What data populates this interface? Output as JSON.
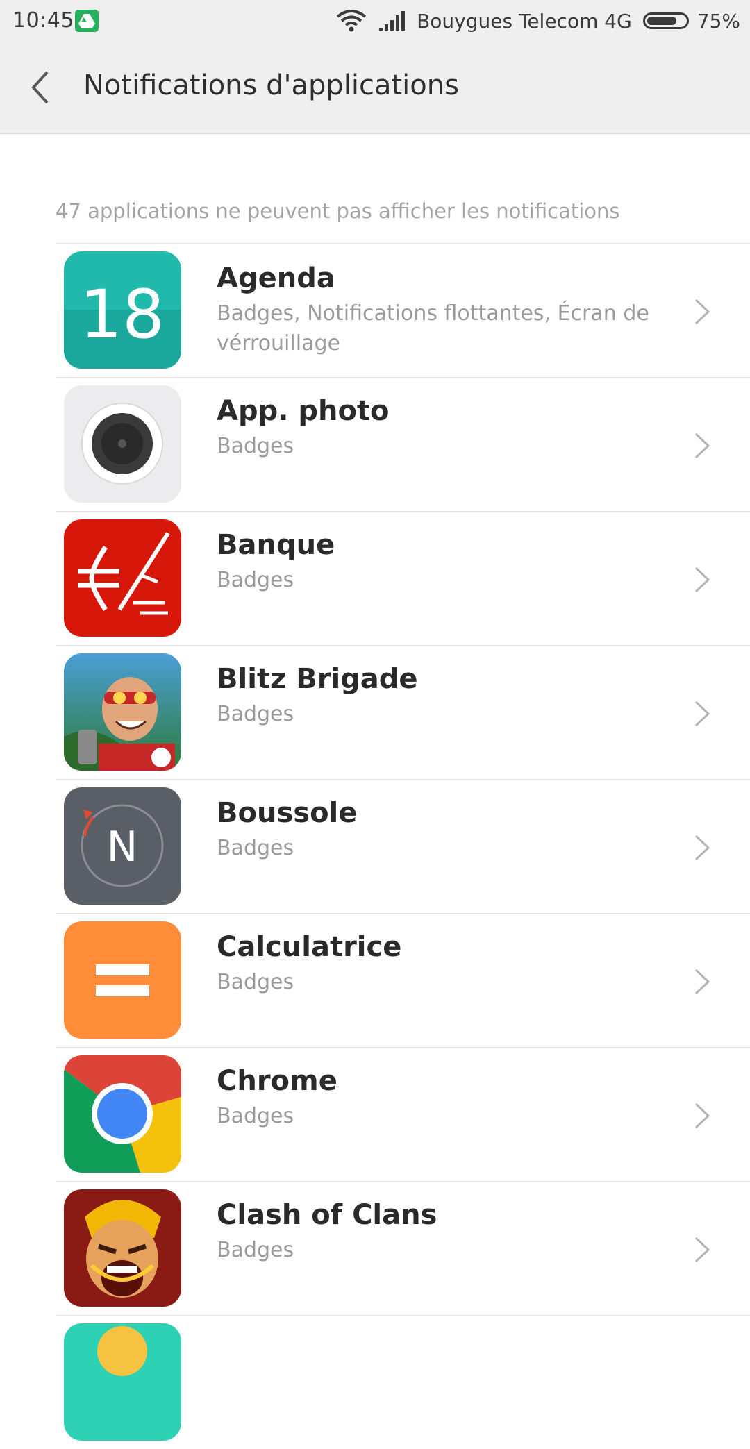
{
  "status_bar": {
    "time": "10:45",
    "carrier": "Bouygues Telecom 4G",
    "battery": "75%",
    "icons": [
      "google-drive-icon",
      "wifi-icon",
      "signal-icon",
      "battery-icon"
    ]
  },
  "header": {
    "title": "Notifications d'applications",
    "back_icon": "chevron-left-icon"
  },
  "section": {
    "label": "47 applications ne peuvent pas afficher les notifications"
  },
  "apps": [
    {
      "name": "Agenda",
      "detail": "Badges, Notifications flottantes, Écran de vérrouillage",
      "icon": "agenda-icon",
      "icon_text": "18"
    },
    {
      "name": "App. photo",
      "detail": "Badges",
      "icon": "camera-icon"
    },
    {
      "name": "Banque",
      "detail": "Badges",
      "icon": "bank-icon"
    },
    {
      "name": "Blitz Brigade",
      "detail": "Badges",
      "icon": "blitz-brigade-icon"
    },
    {
      "name": "Boussole",
      "detail": "Badges",
      "icon": "compass-icon",
      "icon_text": "N"
    },
    {
      "name": "Calculatrice",
      "detail": "Badges",
      "icon": "calculator-icon"
    },
    {
      "name": "Chrome",
      "detail": "Badges",
      "icon": "chrome-icon"
    },
    {
      "name": "Clash of Clans",
      "detail": "Badges",
      "icon": "clash-of-clans-icon"
    }
  ],
  "colors": {
    "header_bg": "#efefef",
    "agenda": "#1fb0a6",
    "bank": "#d8170b",
    "compass": "#5a5e66",
    "calculator": "#ff8c39",
    "drive": "#27b15c"
  }
}
